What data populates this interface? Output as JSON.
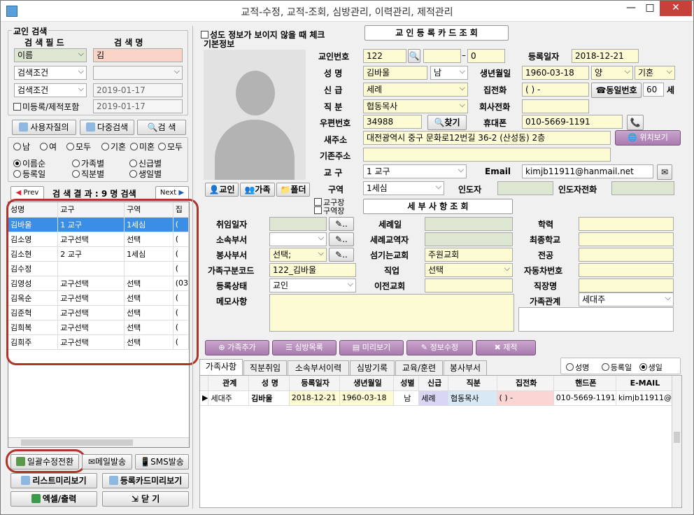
{
  "window": {
    "title": "교적-수정, 교적-조회, 심방관리, 이력관리, 제적관리",
    "min": "—",
    "max": "□",
    "close": "✕"
  },
  "search": {
    "title": "교인 검색",
    "field_header": "검 색 필 드",
    "name_header": "검 색 명",
    "field1": "이름",
    "value1": "김",
    "cond1": "검색조건",
    "cond2": "검색조건",
    "date1": "2019-01-17",
    "date2": "2019-01-17",
    "unregistered": "미등록/제적포함"
  },
  "search_buttons": {
    "user_query": "사용자질의",
    "multi": "다중검색",
    "search": "검   색"
  },
  "filters": {
    "row1": [
      "남",
      "여",
      "모두",
      "기혼",
      "미혼",
      "모두"
    ],
    "row2": [
      "이름순",
      "가족별",
      "신급별"
    ],
    "row3": [
      "등록일",
      "직분별",
      "생일별"
    ]
  },
  "results": {
    "prev": "Prev",
    "next": "Next",
    "label": "검 색 결 과 : 9 명 검색",
    "columns": [
      "성명",
      "교구",
      "구역",
      "집"
    ],
    "rows": [
      [
        "김바울",
        "1 교구",
        "1세심",
        "("
      ],
      [
        "김소영",
        "교구선택",
        "선택",
        "("
      ],
      [
        "김소현",
        "2 교구",
        "1세심",
        "("
      ],
      [
        "김수정",
        "",
        "",
        "("
      ],
      [
        "김영성",
        "교구선택",
        "선택",
        "(03"
      ],
      [
        "김옥순",
        "교구선택",
        "선택",
        "("
      ],
      [
        "김준혁",
        "교구선택",
        "선택",
        "("
      ],
      [
        "김희복",
        "교구선택",
        "선택",
        "("
      ],
      [
        "김희주",
        "교구선택",
        "선택",
        "("
      ]
    ]
  },
  "bottom_buttons": {
    "bulk": "일괄수정전환",
    "mail": "메일발송",
    "sms": "SMS발송",
    "list_preview": "리스트미리보기",
    "card_preview": "등록카드미리보기",
    "excel": "엑셀/출력",
    "close": "닫   기"
  },
  "top": {
    "hide_check": "성도 정보가 보이지 않을 때 체크",
    "card_query": "교 인 등 록 카 드 조 회",
    "basic_info": "기본정보"
  },
  "photo_buttons": {
    "member": "교인",
    "family": "가족",
    "folder": "폴더"
  },
  "basic": {
    "member_no_label": "교인번호",
    "member_no": "122",
    "member_no2": "",
    "member_no3": "0",
    "dash": "–",
    "reg_date_label": "등록일자",
    "reg_date": "2018-12-21",
    "name_label": "성   명",
    "name": "김바울",
    "gender": "남",
    "birth_label": "생년월일",
    "birth": "1960-03-18",
    "calendar": "양",
    "marital": "기혼",
    "faith_label": "신   급",
    "faith": "세례",
    "home_phone_label": "집전화",
    "home_phone": "(   )     -",
    "same_number": "동일번호",
    "same_count": "60",
    "household": "세",
    "duty_label": "직   분",
    "duty": "협동목사",
    "office_phone_label": "회사전화",
    "office_phone": "",
    "zip_label": "우편번호",
    "zip": "34988",
    "find": "찾기",
    "mobile_label": "휴대폰",
    "mobile": "010-5669-1191",
    "new_addr_label": "새주소",
    "new_addr": "대전광역시 중구 문화로12번길 36-2 (산성동) 2층",
    "map": "위치보기",
    "old_addr_label": "기존주소",
    "old_addr": "",
    "parish_label": "교   구",
    "parish": "1 교구",
    "email_label": "Email",
    "email": "kimjb11911@hanmail.net",
    "cell_label": "구역",
    "cell": "1세심",
    "leader_label": "인도자",
    "leader": "",
    "leader_phone_label": "인도자전화",
    "leader_phone": "",
    "parish_head": "교구장",
    "cell_head": "구역장",
    "detail_query": "세 부 사 항 조 회"
  },
  "detail": {
    "appoint_label": "취임일자",
    "baptism_label": "세례일",
    "edu_label": "학력",
    "dept_label": "소속부서",
    "baptism_pastor_label": "세례교역자",
    "school_label": "최종학교",
    "service_label": "봉사부서",
    "service": "선택;",
    "church_label": "섬기는교회",
    "church": "주원교회",
    "major_label": "전공",
    "family_code_label": "가족구분코드",
    "family_code": "122_김바울",
    "job_label": "직업",
    "job": "선택",
    "car_label": "자동차번호",
    "status_label": "등록상태",
    "status": "교인",
    "prev_church_label": "이전교회",
    "work_label": "직장명",
    "memo_label": "메모사항",
    "relation_label": "가족관계",
    "relation": "세대주",
    "more": ".."
  },
  "action_buttons": {
    "add_family": "가족추가",
    "visit_list": "심방목록",
    "preview": "미리보기",
    "update": "정보수정",
    "remove": "제적"
  },
  "tabs": [
    "가족사항",
    "직분취임",
    "소속부서이력",
    "심방기록",
    "교육/훈련",
    "봉사부서"
  ],
  "sort_options": [
    "성명",
    "등록일",
    "생일"
  ],
  "family": {
    "columns": [
      "관계",
      "성   명",
      "등록일자",
      "생년월일",
      "성별",
      "신급",
      "직분",
      "집전화",
      "핸드폰",
      "E-MAIL"
    ],
    "rows": [
      [
        "세대주",
        "김바울",
        "2018-12-21",
        "1960-03-18",
        "남",
        "세례",
        "협동목사",
        "(   )   -",
        "010-5669-1191",
        "kimjb11911@"
      ]
    ]
  }
}
